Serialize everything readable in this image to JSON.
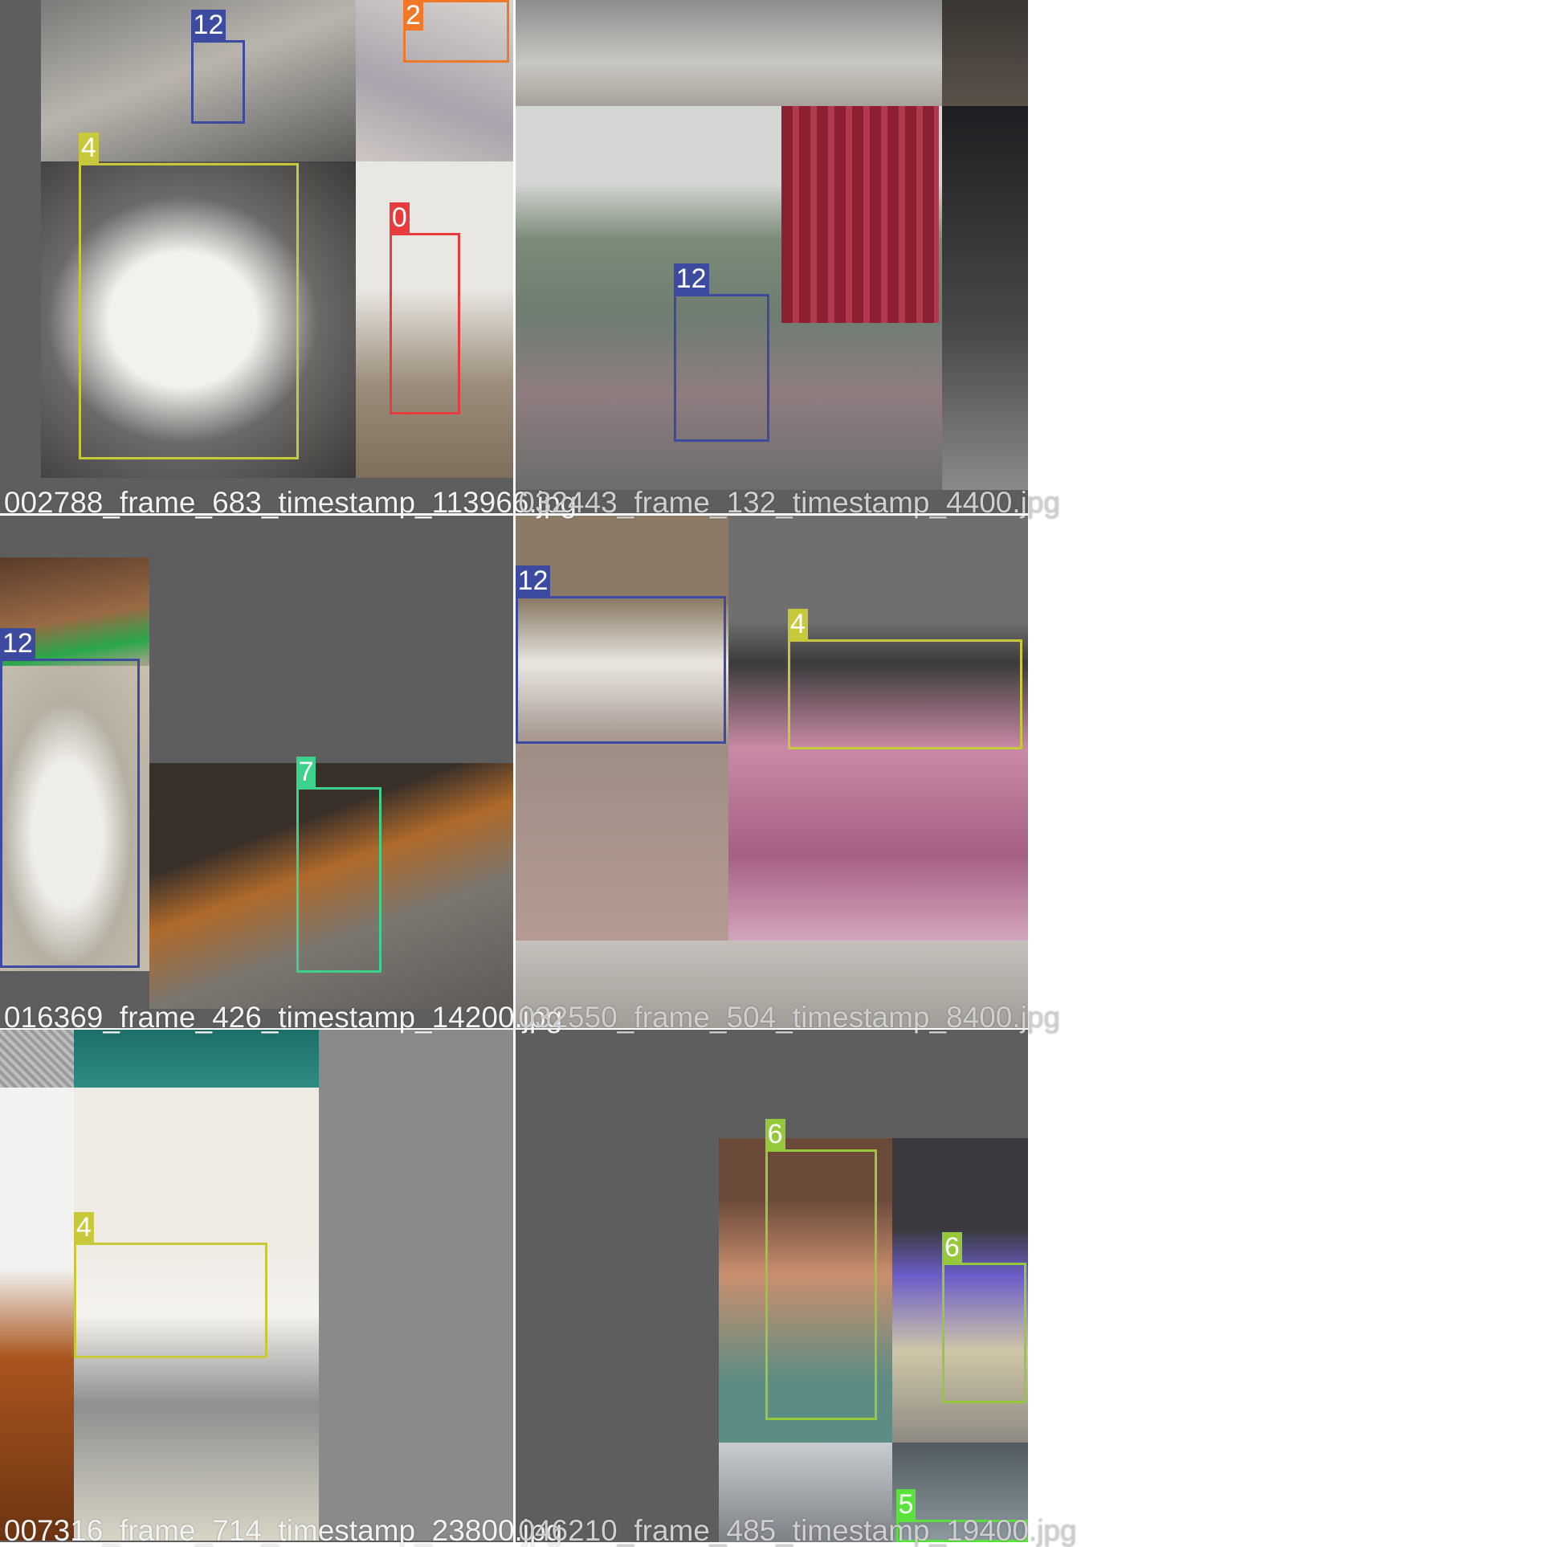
{
  "tiles": [
    {
      "caption": "002788_frame_683_timestamp_113966.jpg",
      "detections": [
        {
          "class_id": "12",
          "color": "#3c4aa0"
        },
        {
          "class_id": "2",
          "color": "#f07828"
        },
        {
          "class_id": "4",
          "color": "#c8c83c"
        },
        {
          "class_id": "0",
          "color": "#e83c3c"
        }
      ]
    },
    {
      "caption": "032443_frame_132_timestamp_4400.jpg",
      "detections": [
        {
          "class_id": "12",
          "color": "#3c4aa0"
        }
      ]
    },
    {
      "caption": "016369_frame_426_timestamp_14200.jpg",
      "detections": [
        {
          "class_id": "12",
          "color": "#3c4aa0"
        },
        {
          "class_id": "7",
          "color": "#3cd28c"
        }
      ]
    },
    {
      "caption": "032550_frame_504_timestamp_8400.jpg",
      "detections": [
        {
          "class_id": "12",
          "color": "#3c4aa0"
        },
        {
          "class_id": "4",
          "color": "#c8c83c"
        }
      ]
    },
    {
      "caption": "007316_frame_714_timestamp_23800.jpg",
      "detections": [
        {
          "class_id": "4",
          "color": "#c8c83c"
        }
      ]
    },
    {
      "caption": "046210_frame_485_timestamp_19400.jpg",
      "detections": [
        {
          "class_id": "6",
          "color": "#96c83c"
        },
        {
          "class_id": "6",
          "color": "#96c83c"
        },
        {
          "class_id": "5",
          "color": "#5ae13c"
        }
      ]
    }
  ]
}
